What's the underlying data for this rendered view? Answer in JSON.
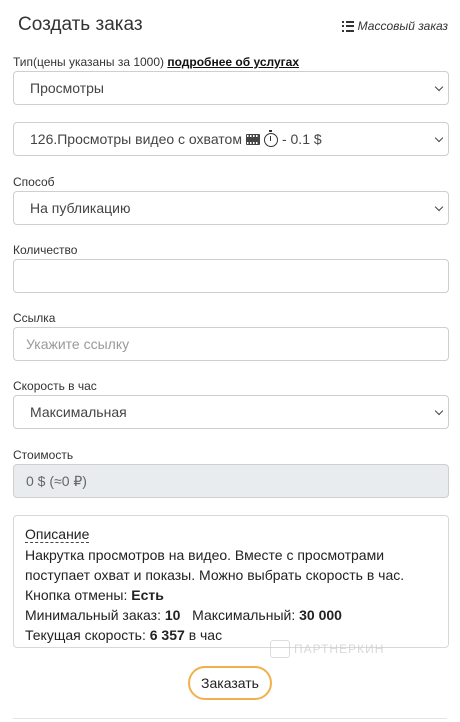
{
  "header": {
    "title": "Создать заказ",
    "mass_order_label": "Массовый заказ"
  },
  "type": {
    "label_prefix": "Тип(цены указаны за 1000)",
    "label_link": "подробнее об услугах",
    "value": "Просмотры"
  },
  "service": {
    "value_text": "126.Просмотры видео с охватом",
    "price_text": "- 0.1 $"
  },
  "method": {
    "label": "Способ",
    "value": "На публикацию"
  },
  "quantity": {
    "label": "Количество",
    "value": ""
  },
  "link": {
    "label": "Ссылка",
    "placeholder": "Укажите ссылку"
  },
  "speed": {
    "label": "Скорость в час",
    "value": "Максимальная"
  },
  "cost": {
    "label": "Стоимость",
    "value": "0 $ (≈0 ₽)"
  },
  "description": {
    "title": "Описание",
    "text": "Накрутка просмотров на видео. Вместе с просмотрами поступает охват и показы. Можно выбрать скорость в час.",
    "cancel_label": "Кнопка отмены:",
    "cancel_value": "Есть",
    "min_label": "Минимальный заказ:",
    "min_value": "10",
    "max_label": "Максимальный:",
    "max_value": "30 000",
    "speed_label": "Текущая скорость:",
    "speed_value": "6 357",
    "speed_unit": "в час"
  },
  "watermark": "ПАРТНЕРКИН",
  "submit_label": "Заказать"
}
